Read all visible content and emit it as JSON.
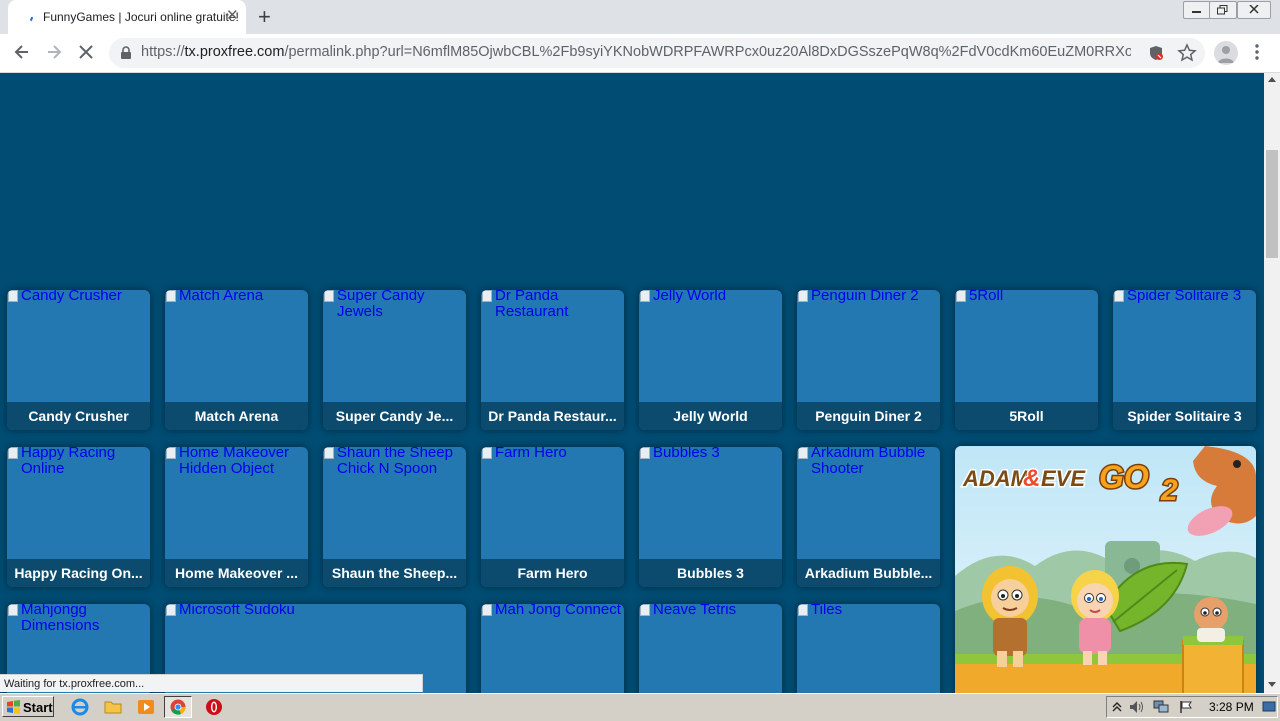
{
  "browser": {
    "tab_title": "FunnyGames | Jocuri online gratuite!",
    "url_scheme": "https://",
    "url_host": "tx.proxfree.com",
    "url_path": "/permalink.php?url=N6mflM85OjwbCBL%2Fb9syiYKNobWDRPFAWRPcx0uz20Al8DxDGSszePqW8q%2FdV0cdKm60EuZM0RRXoA7Igiu...",
    "status_text": "Waiting for tx.proxfree.com..."
  },
  "games": [
    {
      "name": "Candy Crusher",
      "alt": "Candy Crusher",
      "caption": "Candy Crusher"
    },
    {
      "name": "Match Arena",
      "alt": "Match Arena",
      "caption": "Match Arena"
    },
    {
      "name": "Super Candy Jewels",
      "alt": "Super Candy Jewels",
      "caption": "Super Candy Je..."
    },
    {
      "name": "Dr Panda Restaurant",
      "alt": "Dr Panda Restaurant",
      "caption": "Dr Panda Restaur..."
    },
    {
      "name": "Jelly World",
      "alt": "Jelly World",
      "caption": "Jelly World"
    },
    {
      "name": "Penguin Diner 2",
      "alt": "Penguin Diner 2",
      "caption": "Penguin Diner 2"
    },
    {
      "name": "5Roll",
      "alt": "5Roll",
      "caption": "5Roll"
    },
    {
      "name": "Spider Solitaire 3",
      "alt": "Spider Solitaire 3",
      "caption": "Spider Solitaire 3"
    },
    {
      "name": "Happy Racing Online",
      "alt": "Happy Racing Online",
      "caption": "Happy Racing On..."
    },
    {
      "name": "Home Makeover Hidden Object",
      "alt": "Home Makeover Hidden Object",
      "caption": "Home Makeover ..."
    },
    {
      "name": "Shaun the Sheep Chick N Spoon",
      "alt": "Shaun the Sheep Chick N Spoon",
      "caption": "Shaun the Sheep..."
    },
    {
      "name": "Farm Hero",
      "alt": "Farm Hero",
      "caption": "Farm Hero"
    },
    {
      "name": "Bubbles 3",
      "alt": "Bubbles 3",
      "caption": "Bubbles 3"
    },
    {
      "name": "Arkadium Bubble Shooter",
      "alt": "Arkadium Bubble Shooter",
      "caption": "Arkadium Bubble..."
    },
    {
      "name": "Mahjongg Dimensions",
      "alt": "Mahjongg Dimensions"
    },
    {
      "name": "Microsoft Sudoku",
      "alt": "Microsoft Sudoku"
    },
    {
      "name": "Mah Jong Connect",
      "alt": "Mah Jong Connect"
    },
    {
      "name": "Neave Tetris",
      "alt": "Neave Tetris"
    },
    {
      "name": "Tiles",
      "alt": "Tiles"
    }
  ],
  "featured": {
    "logo_adam": "ADAM",
    "logo_amp": "&",
    "logo_eve": "EVE",
    "logo_go": "GO",
    "logo_num": "2"
  },
  "taskbar": {
    "start_label": "Start",
    "clock": "3:28 PM"
  },
  "colors": {
    "page_bg": "#004c73",
    "card_bg": "#2378b1",
    "caption_bg": "#0c4a6e",
    "link_blue": "#0000ee"
  }
}
